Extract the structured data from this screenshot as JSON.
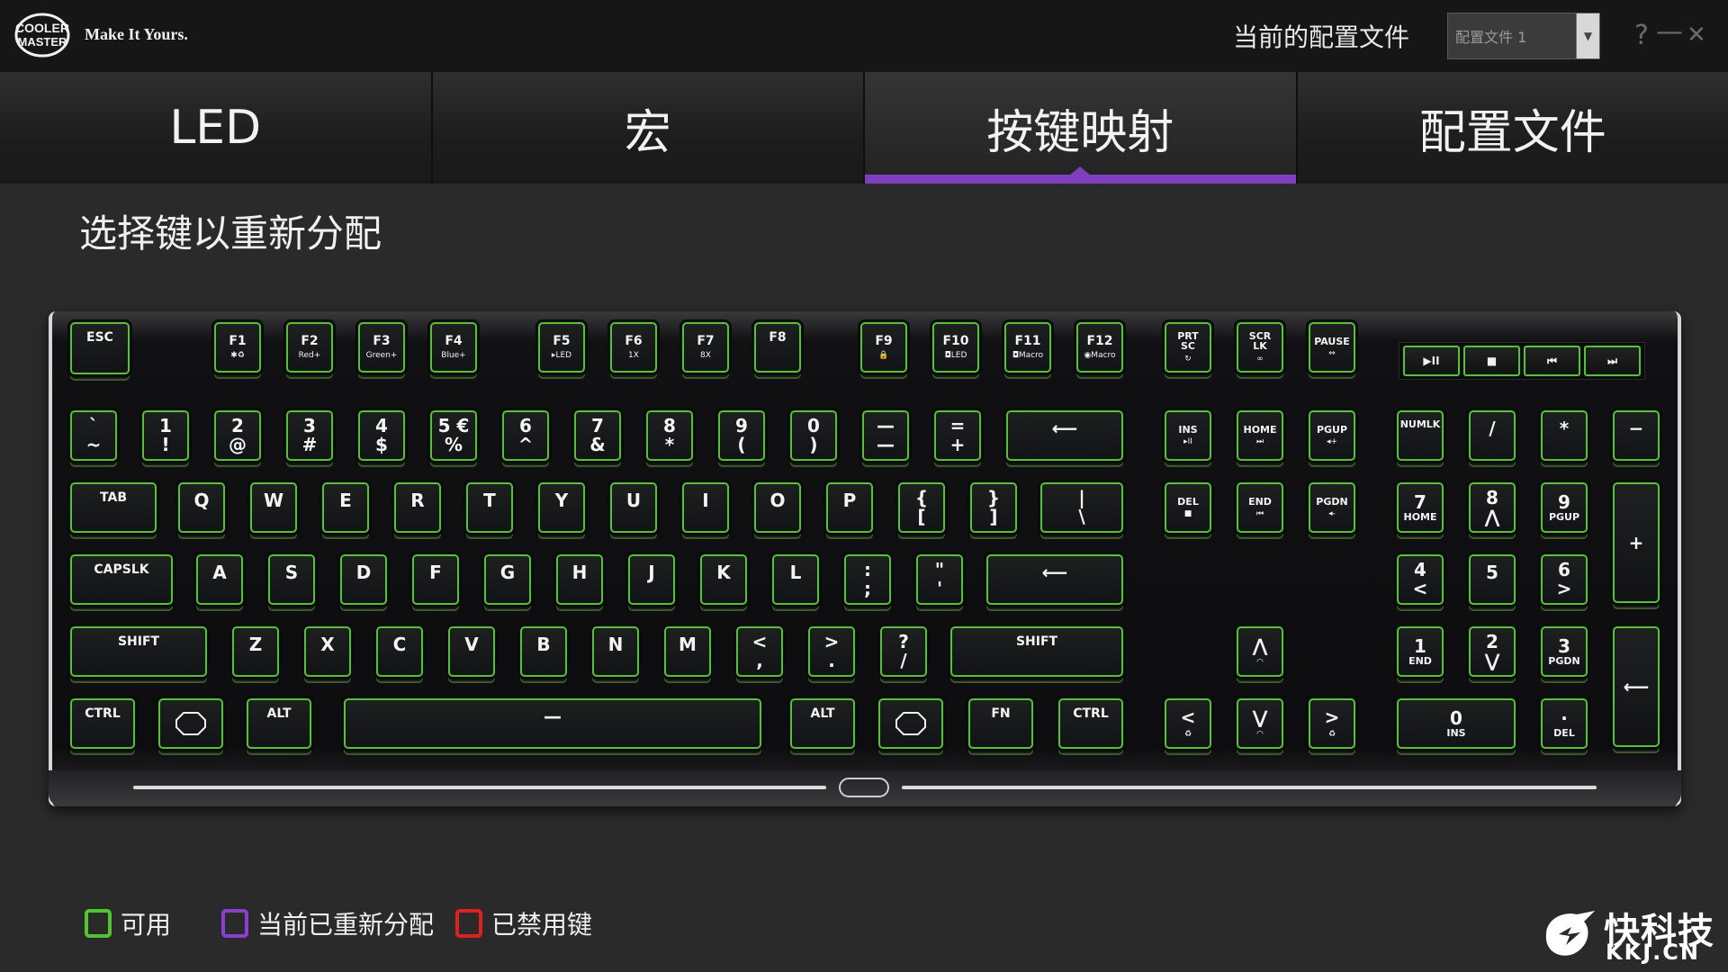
{
  "app": {
    "tagline": "Make It Yours.",
    "brand_logo": "COOLER MASTER",
    "profile_label": "当前的配置文件",
    "profile_value": "配置文件 1",
    "help_icon": "?",
    "minimize_icon": "—",
    "close_icon": "✕"
  },
  "tabs": [
    {
      "label": "LED",
      "active": false
    },
    {
      "label": "宏",
      "active": false
    },
    {
      "label": "按键映射",
      "active": true
    },
    {
      "label": "配置文件",
      "active": false
    }
  ],
  "heading": "选择键以重新分配",
  "colors": {
    "available": "#4ec72c",
    "remapped": "#8a3fd0",
    "disabled": "#e0201c",
    "active_tab": "#7f3fbf"
  },
  "keys": {
    "esc": "ESC",
    "f1": "F1",
    "f1_sub": "✱♻",
    "f2": "F2",
    "f2_sub": "Red+",
    "f3": "F3",
    "f3_sub": "Green+",
    "f4": "F4",
    "f4_sub": "Blue+",
    "f5": "F5",
    "f5_sub": "▸LED",
    "f6": "F6",
    "f6_sub": "1X",
    "f7": "F7",
    "f7_sub": "8X",
    "f8": "F8",
    "f9": "F9",
    "f9_sub": "🔒",
    "f10": "F10",
    "f10_sub": "◘LED",
    "f11": "F11",
    "f11_sub": "◘Macro",
    "f12": "F12",
    "f12_sub": "◉Macro",
    "prtsc1": "PRT",
    "prtsc2": "SC",
    "prtsc_sub": "↻",
    "scrlk1": "SCR",
    "scrlk2": "LK",
    "scrlk_sub": "∞",
    "pause": "PAUSE",
    "pause_sub": "⇔",
    "media": [
      "▶II",
      "■",
      "⏮",
      "⏭"
    ],
    "grave1": "`",
    "grave2": "~",
    "k1a": "1",
    "k1b": "!",
    "k2a": "2",
    "k2b": "@",
    "k3a": "3",
    "k3b": "#",
    "k4a": "4",
    "k4b": "$",
    "k5a": "5 €",
    "k5b": "%",
    "k6a": "6",
    "k6b": "^",
    "k7a": "7",
    "k7b": "&",
    "k8a": "8",
    "k8b": "*",
    "k9a": "9",
    "k9b": "(",
    "k0a": "0",
    "k0b": ")",
    "minus1": "—",
    "minus2": "—",
    "equal1": "=",
    "equal2": "+",
    "backspace": "⟵",
    "ins": "INS",
    "ins_sub": "▸II",
    "home": "HOME",
    "home_sub": "⏭",
    "pgup": "PGUP",
    "pgup_sub": "◂+",
    "numlk": "NUMLK",
    "np_div": "/",
    "np_mul": "*",
    "np_minus": "−",
    "tab": "TAB",
    "q": "Q",
    "w": "W",
    "e": "E",
    "r": "R",
    "t": "T",
    "y": "Y",
    "u": "U",
    "i": "I",
    "o": "O",
    "p": "P",
    "lbr1": "{",
    "lbr2": "[",
    "rbr1": "}",
    "rbr2": "]",
    "bs1": "|",
    "bs2": "\\",
    "del": "DEL",
    "del_sub": "■",
    "end": "END",
    "end_sub": "⏮",
    "pgdn": "PGDN",
    "pgdn_sub": "◂-",
    "np7a": "7",
    "np7b": "HOME",
    "np8a": "8",
    "np8b": "⋀",
    "np9a": "9",
    "np9b": "PGUP",
    "np_plus": "+",
    "capslk": "CAPSLK",
    "a": "A",
    "s": "S",
    "d": "D",
    "f": "F",
    "g": "G",
    "h": "H",
    "j": "J",
    "k": "K",
    "l": "L",
    "semi1": ":",
    "semi2": ";",
    "quote1": "\"",
    "quote2": "'",
    "enter": "⟵",
    "np4a": "4",
    "np4b": "<",
    "np5a": "5",
    "np6a": "6",
    "np6b": ">",
    "lshift": "SHIFT",
    "z": "Z",
    "x": "X",
    "c": "C",
    "v": "V",
    "b": "B",
    "n": "N",
    "m": "M",
    "comma1": "<",
    "comma2": ",",
    "period1": ">",
    "period2": ".",
    "slash1": "?",
    "slash2": "/",
    "rshift": "SHIFT",
    "up": "⋀",
    "up_sub": "◠",
    "np1a": "1",
    "np1b": "END",
    "np2a": "2",
    "np2b": "⋁",
    "np3a": "3",
    "np3b": "PGDN",
    "np_enter": "⟵",
    "lctrl": "CTRL",
    "lalt": "ALT",
    "space": "—",
    "ralt": "ALT",
    "fn": "FN",
    "rctrl": "CTRL",
    "left": "<",
    "left_sub": "♻",
    "down": "⋁",
    "down_sub": "◠",
    "right": ">",
    "right_sub": "♻",
    "np0a": "0",
    "np0b": "INS",
    "npdot_a": "·",
    "npdot_b": "DEL"
  },
  "legend": {
    "available": "可用",
    "remapped": "当前已重新分配",
    "disabled": "已禁用键"
  },
  "watermark": {
    "line1": "快科技",
    "line2": "KKJ.CN"
  }
}
